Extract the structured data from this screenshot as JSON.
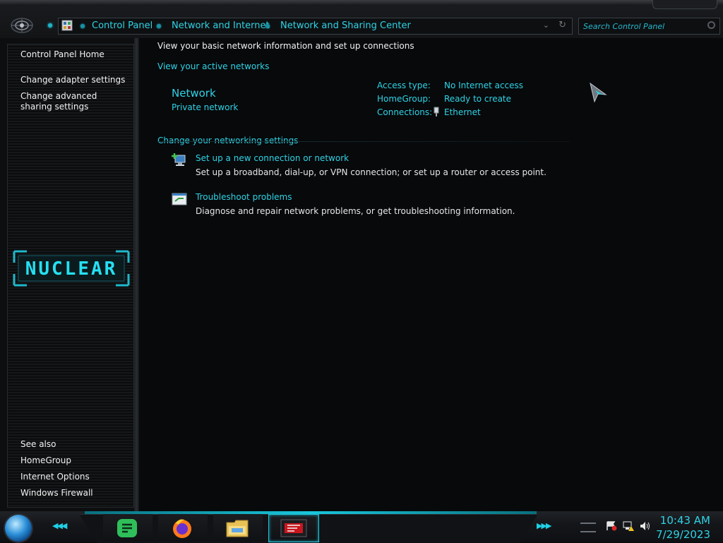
{
  "address_bar": {
    "breadcrumbs": [
      "Control Panel",
      "Network and Internet",
      "Network and Sharing Center"
    ],
    "search_placeholder": "Search Control Panel"
  },
  "sidebar": {
    "top_links": [
      "Control Panel Home",
      "Change adapter settings",
      "Change advanced sharing settings"
    ],
    "logo_text": "NUCLEAR",
    "see_also_heading": "See also",
    "see_also_links": [
      "HomeGroup",
      "Internet Options",
      "Windows Firewall"
    ]
  },
  "main": {
    "heading": "View your basic network information and set up connections",
    "active_networks_label": "View your active networks",
    "network": {
      "name": "Network",
      "type": "Private network",
      "access_type_label": "Access type:",
      "access_type_value": "No Internet access",
      "homegroup_label": "HomeGroup:",
      "homegroup_value": "Ready to create",
      "connections_label": "Connections:",
      "connections_value": "Ethernet"
    },
    "change_settings_label": "Change your networking settings",
    "tasks": [
      {
        "title": "Set up a new connection or network",
        "description": "Set up a broadband, dial-up, or VPN connection; or set up a router or access point.",
        "icon": "new-connection-icon"
      },
      {
        "title": "Troubleshoot problems",
        "description": "Diagnose and repair network problems, or get troubleshooting information.",
        "icon": "troubleshoot-icon"
      }
    ]
  },
  "taskbar": {
    "pinned_icons": [
      "notes-app-icon",
      "firefox-icon",
      "file-explorer-icon",
      "active-window-thumbnail-icon"
    ],
    "tray_icons": [
      "action-center-flag-icon",
      "network-no-internet-icon",
      "volume-icon"
    ],
    "time": "10:43 AM",
    "date": "7/29/2023"
  },
  "colors": {
    "accent": "#2fd3e5",
    "background": "#07090b",
    "text": "#e6e6e6"
  }
}
